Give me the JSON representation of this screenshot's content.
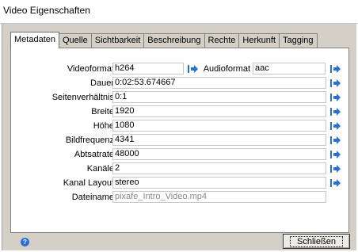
{
  "window": {
    "title": "Video Eigenschaften"
  },
  "tabs": [
    {
      "label": "Metadaten",
      "active": true
    },
    {
      "label": "Quelle"
    },
    {
      "label": "Sichtbarkeit"
    },
    {
      "label": "Beschreibung"
    },
    {
      "label": "Rechte"
    },
    {
      "label": "Herkunft"
    },
    {
      "label": "Tagging"
    }
  ],
  "fields": {
    "videoformat": {
      "label": "Videoformat",
      "value": "h264"
    },
    "audioformat": {
      "label": "Audioformat",
      "value": "aac"
    },
    "dauer": {
      "label": "Dauer",
      "value": "0:02:53.674667"
    },
    "seitenverhaeltnis": {
      "label": "Seitenverhältnis",
      "value": "0:1"
    },
    "breite": {
      "label": "Breite",
      "value": "1920"
    },
    "hoehe": {
      "label": "Höhe",
      "value": "1080"
    },
    "bildfrequenz": {
      "label": "Bildfrequenz",
      "value": "4341"
    },
    "abtastrate": {
      "label": "Abtsatrate",
      "value": "48000"
    },
    "kanaele": {
      "label": "Kanäle",
      "value": "2"
    },
    "kanal_layout": {
      "label": "Kanal Layout",
      "value": "stereo"
    },
    "dateiname": {
      "label": "Dateiname",
      "value": "pixafe_Intro_Video.mp4"
    }
  },
  "footer": {
    "close_label": "Schließen"
  },
  "icons": {
    "insert": "arrow-insert-icon",
    "help": "help-icon"
  },
  "colors": {
    "accent": "#2a6fd6",
    "panel_bg": "#d4d0c8"
  }
}
